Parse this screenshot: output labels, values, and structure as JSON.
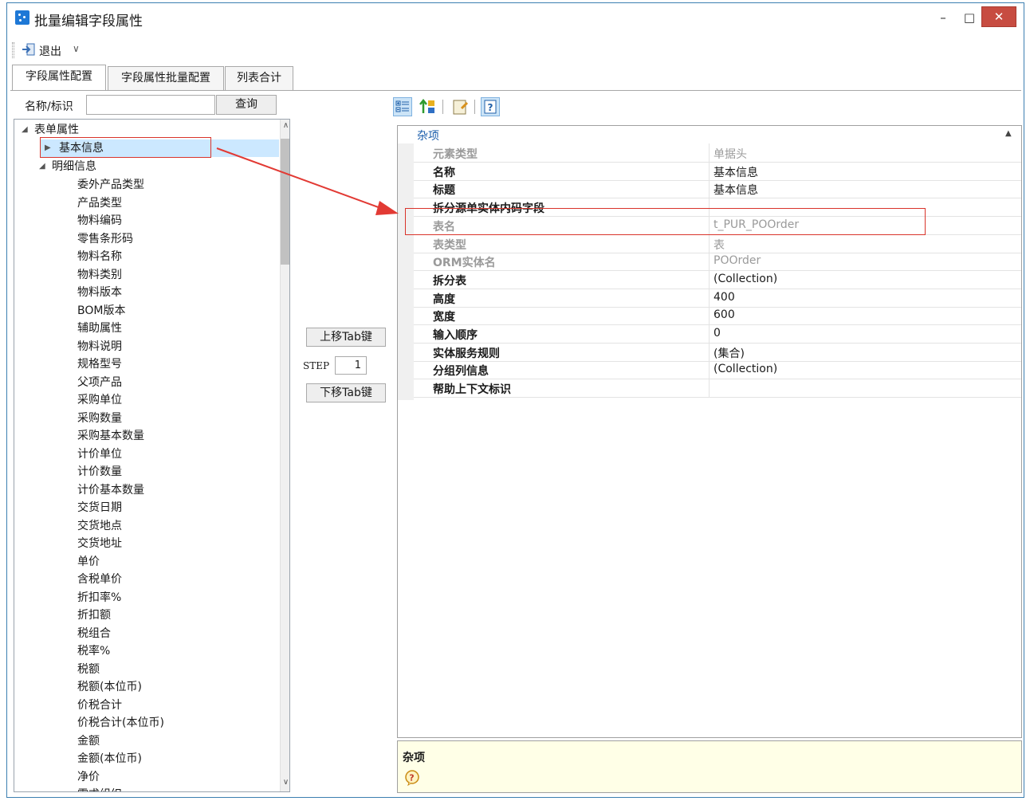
{
  "window": {
    "title": "批量编辑字段属性",
    "min": "–",
    "max": "□",
    "close": "✕"
  },
  "toolbar": {
    "exit_label": "退出",
    "exit_chevron": "∨"
  },
  "tabs": [
    {
      "label": "字段属性配置",
      "active": true
    },
    {
      "label": "字段属性批量配置",
      "active": false
    },
    {
      "label": "列表合计",
      "active": false
    }
  ],
  "search": {
    "label": "名称/标识",
    "value": "",
    "button": "查询"
  },
  "tree": {
    "root": "表单属性",
    "basic": "基本信息",
    "detail": "明细信息",
    "fields": [
      "委外产品类型",
      "产品类型",
      "物料编码",
      "零售条形码",
      "物料名称",
      "物料类别",
      "物料版本",
      "BOM版本",
      "辅助属性",
      "物料说明",
      "规格型号",
      "父项产品",
      "采购单位",
      "采购数量",
      "采购基本数量",
      "计价单位",
      "计价数量",
      "计价基本数量",
      "交货日期",
      "交货地点",
      "交货地址",
      "单价",
      "含税单价",
      "折扣率%",
      "折扣额",
      "税组合",
      "税率%",
      "税额",
      "税额(本位币)",
      "价税合计",
      "价税合计(本位币)",
      "金额",
      "金额(本位币)",
      "净价",
      "需求组织"
    ]
  },
  "middle": {
    "up_button": "上移Tab键",
    "step_label": "STEP",
    "step_value": "1",
    "down_button": "下移Tab键"
  },
  "grid": {
    "category": "杂项",
    "rows": [
      {
        "name": "元素类型",
        "value": "单据头",
        "readonly": true
      },
      {
        "name": "名称",
        "value": "基本信息",
        "readonly": false
      },
      {
        "name": "标题",
        "value": "基本信息",
        "readonly": false
      },
      {
        "name": "拆分源单实体内码字段",
        "value": "",
        "readonly": false
      },
      {
        "name": "表名",
        "value": "t_PUR_POOrder",
        "readonly": true
      },
      {
        "name": "表类型",
        "value": "表",
        "readonly": true
      },
      {
        "name": "ORM实体名",
        "value": "POOrder",
        "readonly": true
      },
      {
        "name": "拆分表",
        "value": "(Collection)",
        "readonly": false
      },
      {
        "name": "高度",
        "value": "400",
        "readonly": false
      },
      {
        "name": "宽度",
        "value": "600",
        "readonly": false
      },
      {
        "name": "输入顺序",
        "value": "0",
        "readonly": false
      },
      {
        "name": "实体服务规则",
        "value": "(集合)",
        "readonly": false
      },
      {
        "name": "分组列信息",
        "value": "(Collection)",
        "readonly": false
      },
      {
        "name": "帮助上下文标识",
        "value": "",
        "readonly": false
      }
    ]
  },
  "help": {
    "title": "杂项"
  },
  "colors": {
    "accent": "#1e78d6",
    "close": "#c74c41",
    "highlight": "#d9342b",
    "selection": "#cce8ff",
    "help_bg": "#ffffe7"
  }
}
